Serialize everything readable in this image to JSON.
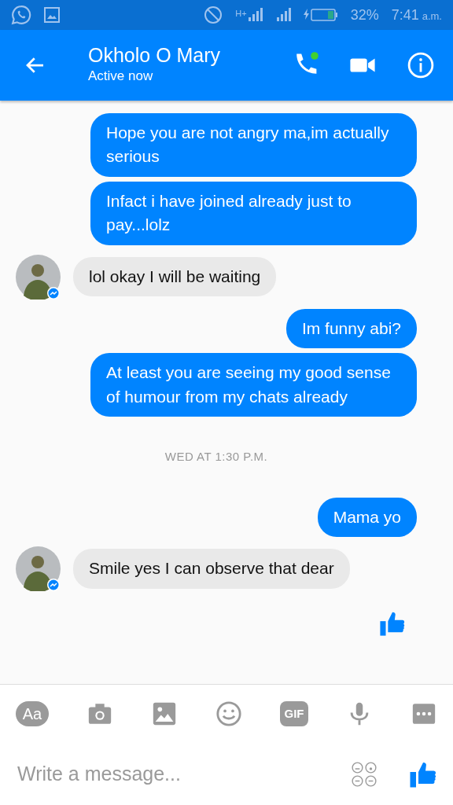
{
  "status_bar": {
    "network": "H+",
    "battery": "32%",
    "time": "7:41",
    "time_suffix": "a.m."
  },
  "header": {
    "title": "Okholo O Mary",
    "subtitle": "Active now",
    "call_online": true
  },
  "messages": [
    {
      "kind": "sent",
      "text": "Hope you are not angry ma,im actually serious"
    },
    {
      "kind": "sent",
      "text": "Infact i have joined already just to pay...lolz"
    },
    {
      "kind": "received",
      "text": "lol okay I will be waiting"
    },
    {
      "kind": "sent",
      "text": "Im funny abi?"
    },
    {
      "kind": "sent",
      "text": "At least you are seeing my good sense of humour from my chats already"
    },
    {
      "kind": "timestamp",
      "text": "WED AT 1:30 P.M."
    },
    {
      "kind": "sent",
      "text": "Mama yo"
    },
    {
      "kind": "received",
      "text": "Smile yes I can observe that dear"
    },
    {
      "kind": "like"
    }
  ],
  "toolbar": [
    {
      "kind": "text",
      "label": "Aa"
    },
    {
      "kind": "camera"
    },
    {
      "kind": "image"
    },
    {
      "kind": "emoji"
    },
    {
      "kind": "gif",
      "label": "GIF"
    },
    {
      "kind": "mic"
    },
    {
      "kind": "more"
    }
  ],
  "composer": {
    "placeholder": "Write a message..."
  }
}
